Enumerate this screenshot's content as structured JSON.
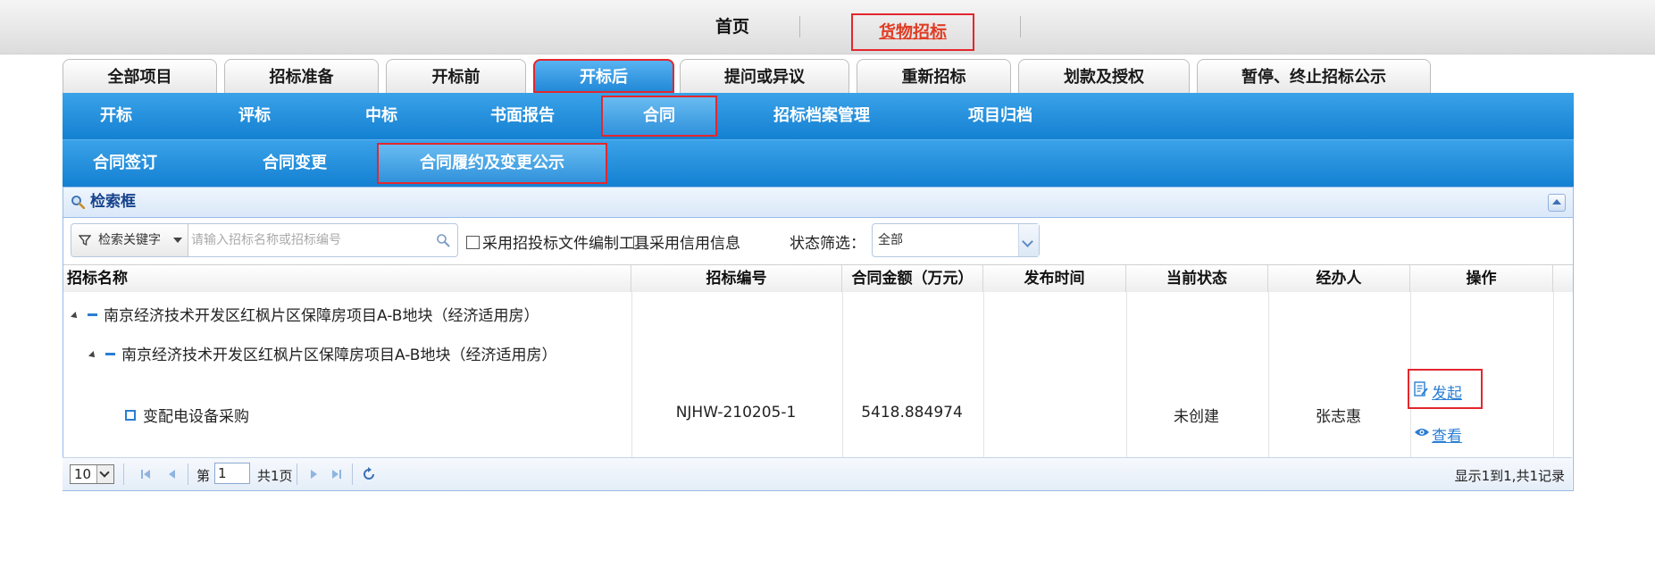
{
  "top_nav": {
    "home": "首页",
    "goods": "货物招标"
  },
  "tabs": [
    {
      "label": "全部项目"
    },
    {
      "label": "招标准备"
    },
    {
      "label": "开标前"
    },
    {
      "label": "开标后"
    },
    {
      "label": "提问或异议"
    },
    {
      "label": "重新招标"
    },
    {
      "label": "划款及授权"
    },
    {
      "label": "暂停、终止招标公示"
    }
  ],
  "subnav1": [
    {
      "label": "开标"
    },
    {
      "label": "评标"
    },
    {
      "label": "中标"
    },
    {
      "label": "书面报告"
    },
    {
      "label": "合同"
    },
    {
      "label": "招标档案管理"
    },
    {
      "label": "项目归档"
    }
  ],
  "subnav2": [
    {
      "label": "合同签订"
    },
    {
      "label": "合同变更"
    },
    {
      "label": "合同履约及变更公示"
    }
  ],
  "search_panel": {
    "title": "检索框",
    "keyword_button": "检索关键字",
    "input_placeholder": "请输入招标名称或招标编号",
    "check_tool": "采用招投标文件编制工具",
    "check_credit": "采用信用信息",
    "status_label": "状态筛选：",
    "status_value": "全部"
  },
  "table": {
    "columns": [
      "招标名称",
      "招标编号",
      "合同金额（万元）",
      "发布时间",
      "当前状态",
      "经办人",
      "操作"
    ],
    "tree_level1": "南京经济技术开发区红枫片区保障房项目A-B地块（经济适用房）",
    "tree_level2": "南京经济技术开发区红枫片区保障房项目A-B地块（经济适用房）",
    "row": {
      "name": "变配电设备采购",
      "code": "NJHW-210205-1",
      "amount": "5418.884974",
      "publish_time": "",
      "status": "未创建",
      "handler": "张志惠",
      "op_start": "发起",
      "op_view": "查看"
    }
  },
  "pager": {
    "page_size": "10",
    "page_prefix": "第",
    "page_value": "1",
    "page_total": "共1页",
    "info": "显示1到1,共1记录"
  }
}
